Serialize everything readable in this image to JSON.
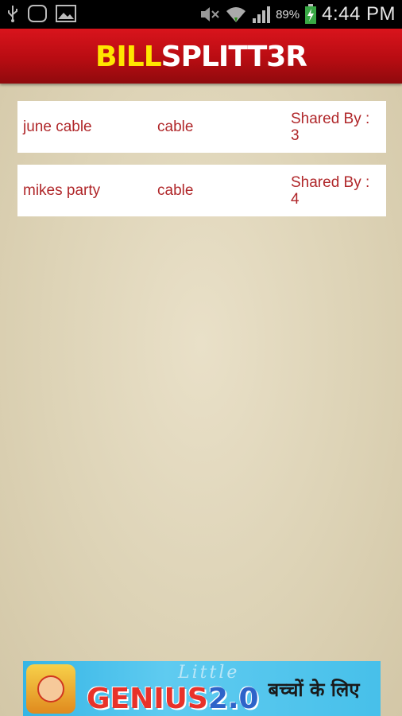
{
  "status_bar": {
    "battery": "89%",
    "time": "4:44 PM",
    "icons": [
      "usb-icon",
      "notification-icon",
      "image-icon",
      "mute-icon",
      "wifi-icon",
      "signal-icon",
      "battery-icon"
    ]
  },
  "header": {
    "logo_part1": "BILL",
    "logo_part2": "SPLITT3R",
    "colors": {
      "bar": "#c0121a",
      "logo_accent": "#ffe600"
    }
  },
  "bills": [
    {
      "name": "june cable",
      "category": "cable",
      "shared_by": "Shared By : 3"
    },
    {
      "name": "mikes party",
      "category": "cable",
      "shared_by": "Shared By : 4"
    }
  ],
  "ad": {
    "little": "Little",
    "genius": "GENIUS",
    "version": "2.0",
    "hindi": "बच्चों के लिए"
  }
}
